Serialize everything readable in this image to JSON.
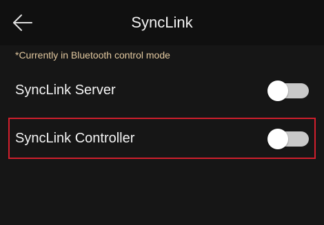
{
  "header": {
    "title": "SyncLink",
    "back_icon": "arrow-left-icon"
  },
  "notice": {
    "text": "*Currently in Bluetooth control mode",
    "color": "#e3c9a0"
  },
  "settings": [
    {
      "label": "SyncLink Server",
      "enabled": false
    },
    {
      "label": "SyncLink Controller",
      "enabled": false,
      "highlighted": true
    }
  ],
  "colors": {
    "background": "#161616",
    "header_background": "#101010",
    "highlight_border": "#d21f2d",
    "toggle_track_off": "#c9c9c9",
    "toggle_knob": "#ffffff"
  }
}
